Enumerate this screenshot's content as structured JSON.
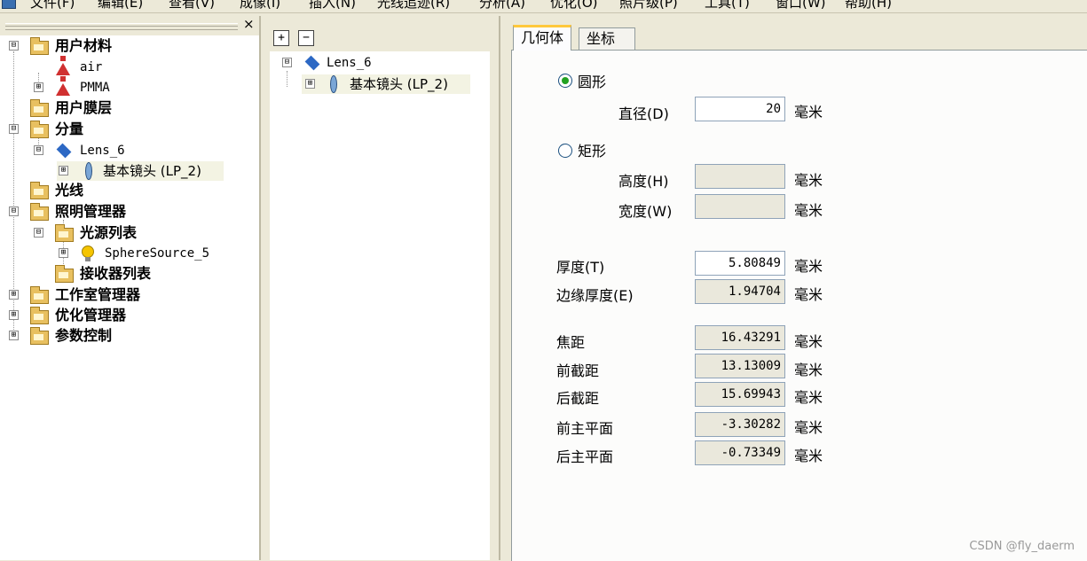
{
  "menu": [
    "文件(F)",
    "编辑(E)",
    "查看(V)",
    "成像(I)",
    "插入(N)",
    "光线追迹(R)",
    "分析(A)",
    "优化(O)",
    "照片级(P)",
    "工具(T)",
    "窗口(W)",
    "帮助(H)"
  ],
  "left_tree": {
    "close_glyph": "×",
    "items": [
      {
        "label": "用户材料",
        "icon": "folder-icon",
        "expander": "⊟"
      },
      {
        "label": "air",
        "icon": "flask-icon",
        "expander": ""
      },
      {
        "label": "PMMA",
        "icon": "flask-icon",
        "expander": "⊞"
      },
      {
        "label": "用户膜层",
        "icon": "folder-icon",
        "expander": ""
      },
      {
        "label": "分量",
        "icon": "folder-icon",
        "expander": "⊟"
      },
      {
        "label": "Lens_6",
        "icon": "lens-assembly-icon",
        "expander": "⊟"
      },
      {
        "label": "基本镜头 (LP_2)",
        "icon": "lens-icon",
        "expander": "⊞"
      },
      {
        "label": "光线",
        "icon": "folder-icon",
        "expander": ""
      },
      {
        "label": "照明管理器",
        "icon": "folder-icon",
        "expander": "⊟"
      },
      {
        "label": "光源列表",
        "icon": "folder-icon",
        "expander": "⊟"
      },
      {
        "label": "SphereSource_5",
        "icon": "bulb-icon",
        "expander": "⊞"
      },
      {
        "label": "接收器列表",
        "icon": "folder-icon",
        "expander": ""
      },
      {
        "label": "工作室管理器",
        "icon": "folder-icon",
        "expander": "⊞"
      },
      {
        "label": "优化管理器",
        "icon": "folder-icon",
        "expander": "⊞"
      },
      {
        "label": "参数控制",
        "icon": "folder-icon",
        "expander": "⊞"
      }
    ]
  },
  "mid_pane": {
    "expand_all": "+",
    "collapse_all": "−",
    "items": [
      {
        "label": "Lens_6",
        "icon": "lens-assembly-icon",
        "expander": "⊟"
      },
      {
        "label": "基本镜头 (LP_2)",
        "icon": "lens-icon",
        "expander": "⊞"
      }
    ]
  },
  "tabs": [
    "几何体",
    "坐标"
  ],
  "geometry": {
    "circle_label": "圆形",
    "circle_selected": true,
    "diameter_label": "直径(D)",
    "diameter_value": "20",
    "rect_label": "矩形",
    "rect_selected": false,
    "height_label": "高度(H)",
    "height_value": "",
    "width_label": "宽度(W)",
    "width_value": "",
    "thickness_label": "厚度(T)",
    "thickness_value": "5.80849",
    "edge_thickness_label": "边缘厚度(E)",
    "edge_thickness_value": "1.94704",
    "focal_label": "焦距",
    "focal_value": "16.43291",
    "front_bfl_label": "前截距",
    "front_bfl_value": "13.13009",
    "back_bfl_label": "后截距",
    "back_bfl_value": "15.69943",
    "front_principal_label": "前主平面",
    "front_principal_value": "-3.30282",
    "back_principal_label": "后主平面",
    "back_principal_value": "-0.73349",
    "unit": "毫米"
  },
  "watermark": "CSDN @fly_daerm"
}
